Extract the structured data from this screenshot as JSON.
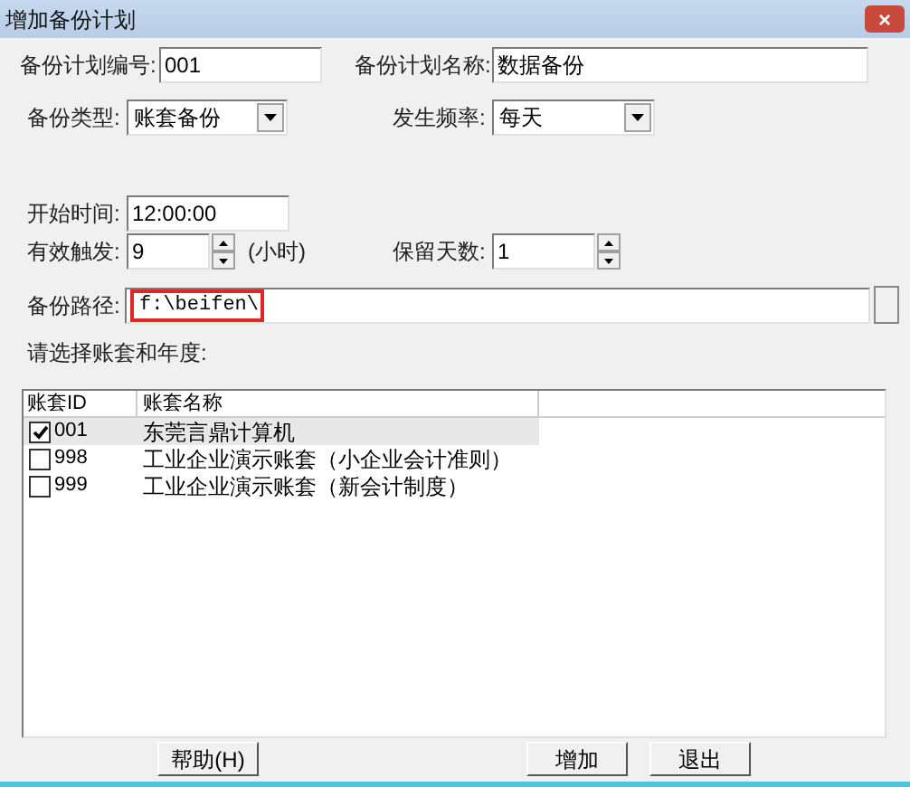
{
  "window": {
    "title": "增加备份计划",
    "close": "×"
  },
  "plan_no": {
    "label": "备份计划编号:",
    "value": "001"
  },
  "plan_name": {
    "label": "备份计划名称:",
    "value": "数据备份"
  },
  "backup_type": {
    "label": "备份类型:",
    "value": "账套备份"
  },
  "frequency": {
    "label": "发生频率:",
    "value": "每天"
  },
  "start_time": {
    "label": "开始时间:",
    "value": "12:00:00"
  },
  "trigger": {
    "label": "有效触发:",
    "value": "9",
    "unit": "(小时)"
  },
  "keep_days": {
    "label": "保留天数:",
    "value": "1"
  },
  "path": {
    "label": "备份路径:",
    "value": "f:\\beifen\\",
    "highlighted": true
  },
  "prompt": "请选择账套和年度:",
  "table": {
    "columns": [
      "账套ID",
      "账套名称"
    ],
    "rows": [
      {
        "id": "001",
        "name": "东莞言鼎计算机",
        "checked": true,
        "selected": true
      },
      {
        "id": "998",
        "name": "工业企业演示账套（小企业会计准则）",
        "checked": false,
        "selected": false
      },
      {
        "id": "999",
        "name": "工业企业演示账套（新会计制度）",
        "checked": false,
        "selected": false
      }
    ]
  },
  "buttons": [
    {
      "label": "帮助(H)"
    },
    {
      "label": "增加"
    },
    {
      "label": "退出"
    }
  ]
}
